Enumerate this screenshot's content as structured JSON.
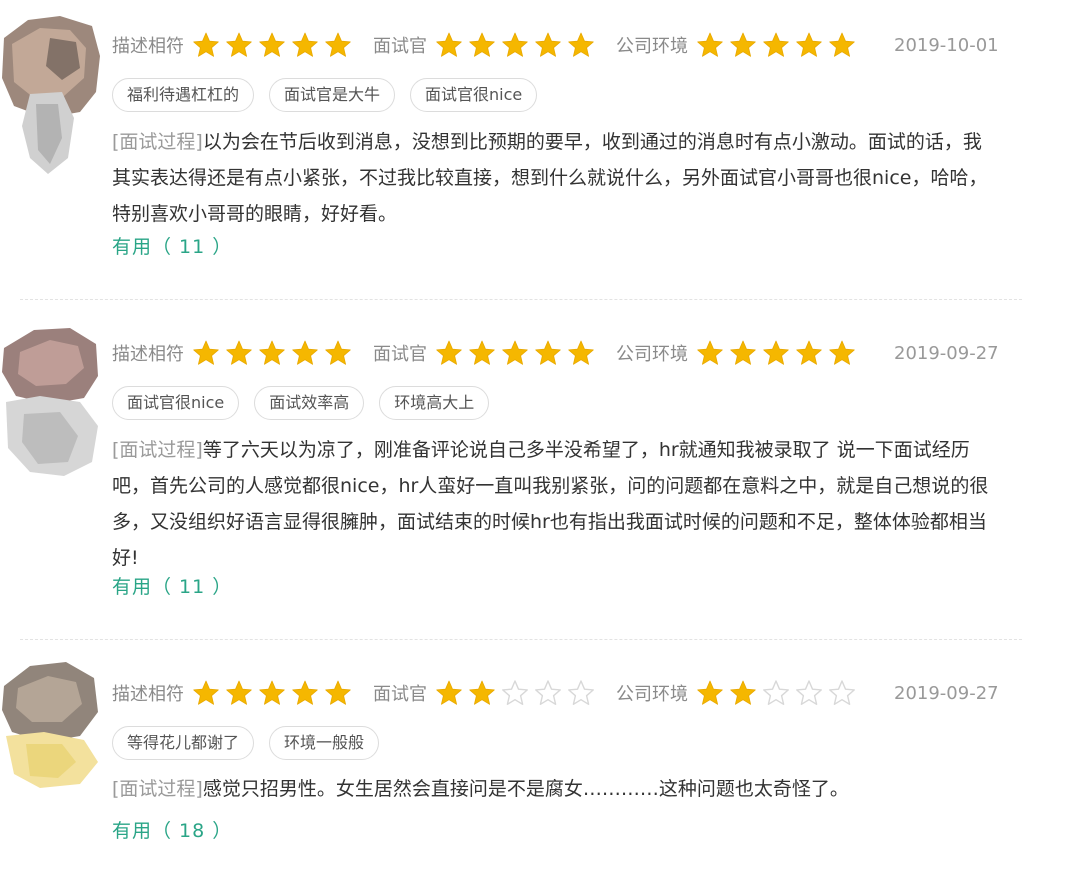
{
  "colors": {
    "star_filled": "#F5B700",
    "star_empty": "#D8D8D8",
    "useful_text": "#2AA587",
    "prefix_text": "#9A9A9A"
  },
  "reviews": [
    {
      "ratings": [
        {
          "label": "描述相符",
          "stars": 5
        },
        {
          "label": "面试官",
          "stars": 5
        },
        {
          "label": "公司环境",
          "stars": 5
        }
      ],
      "date": "2019-10-01",
      "tags": [
        "福利待遇杠杠的",
        "面试官是大牛",
        "面试官很nice"
      ],
      "prefix": "[面试过程]",
      "text": "以为会在节后收到消息，没想到比预期的要早，收到通过的消息时有点小激动。面试的话，我其实表达得还是有点小紧张，不过我比较直接，想到什么就说什么，另外面试官小哥哥也很nice，哈哈，特别喜欢小哥哥的眼睛，好好看。",
      "useful": "有用（ 11 ）"
    },
    {
      "ratings": [
        {
          "label": "描述相符",
          "stars": 5
        },
        {
          "label": "面试官",
          "stars": 5
        },
        {
          "label": "公司环境",
          "stars": 5
        }
      ],
      "date": "2019-09-27",
      "tags": [
        "面试官很nice",
        "面试效率高",
        "环境高大上"
      ],
      "prefix": "[面试过程]",
      "text": "等了六天以为凉了，刚准备评论说自己多半没希望了，hr就通知我被录取了 说一下面试经历吧，首先公司的人感觉都很nice，hr人蛮好一直叫我别紧张，问的问题都在意料之中，就是自己想说的很多，又没组织好语言显得很臃肿，面试结束的时候hr也有指出我面试时候的问题和不足，整体体验都相当好!",
      "useful": "有用（ 11 ）"
    },
    {
      "ratings": [
        {
          "label": "描述相符",
          "stars": 5
        },
        {
          "label": "面试官",
          "stars": 2
        },
        {
          "label": "公司环境",
          "stars": 2
        }
      ],
      "date": "2019-09-27",
      "tags": [
        "等得花儿都谢了",
        "环境一般般"
      ],
      "prefix": "[面试过程]",
      "text": "感觉只招男性。女生居然会直接问是不是腐女…………这种问题也太奇怪了。",
      "useful": "有用（ 18 ）"
    }
  ]
}
